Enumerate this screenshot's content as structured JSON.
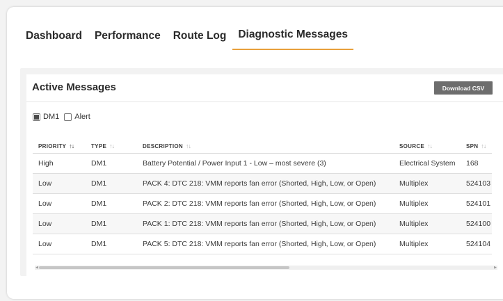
{
  "tabs": [
    {
      "label": "Dashboard",
      "active": false
    },
    {
      "label": "Performance",
      "active": false
    },
    {
      "label": "Route Log",
      "active": false
    },
    {
      "label": "Diagnostic Messages",
      "active": true
    }
  ],
  "accent_color": "#e8a03b",
  "panel": {
    "title": "Active Messages",
    "download_label": "Download CSV"
  },
  "filters": [
    {
      "label": "DM1",
      "checked": true
    },
    {
      "label": "Alert",
      "checked": false
    }
  ],
  "table": {
    "columns": [
      "PRIORITY",
      "TYPE",
      "DESCRIPTION",
      "SOURCE",
      "SPN"
    ],
    "rows": [
      {
        "priority": "High",
        "type": "DM1",
        "description": "Battery Potential / Power Input 1 - Low – most severe (3)",
        "source": "Electrical System",
        "spn": "168"
      },
      {
        "priority": "Low",
        "type": "DM1",
        "description": "PACK 4: DTC 218: VMM reports fan error (Shorted, High, Low, or Open)",
        "source": "Multiplex",
        "spn": "524103"
      },
      {
        "priority": "Low",
        "type": "DM1",
        "description": "PACK 2: DTC 218: VMM reports fan error (Shorted, High, Low, or Open)",
        "source": "Multiplex",
        "spn": "524101"
      },
      {
        "priority": "Low",
        "type": "DM1",
        "description": "PACK 1: DTC 218: VMM reports fan error (Shorted, High, Low, or Open)",
        "source": "Multiplex",
        "spn": "524100"
      },
      {
        "priority": "Low",
        "type": "DM1",
        "description": "PACK 5: DTC 218: VMM reports fan error (Shorted, High, Low, or Open)",
        "source": "Multiplex",
        "spn": "524104"
      }
    ]
  }
}
